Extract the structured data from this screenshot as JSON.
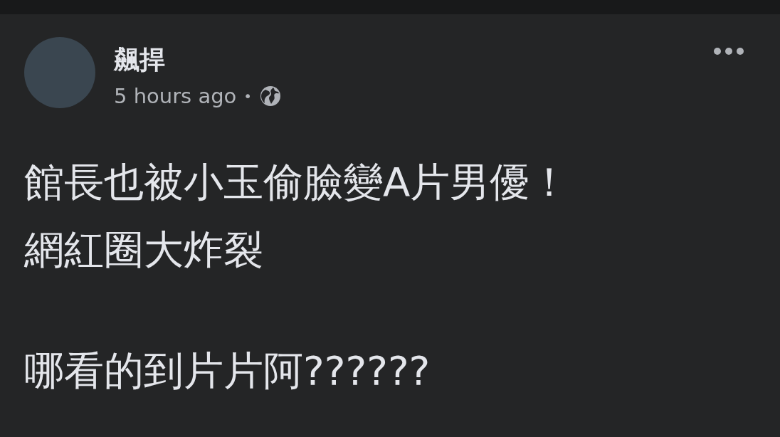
{
  "post": {
    "author": "飆捍",
    "time": "5 hours ago",
    "separator": "•",
    "paragraphs": [
      [
        "館長也被小玉偷臉變A片男優！",
        "網紅圈大炸裂"
      ],
      [
        "哪看的到片片阿??????"
      ]
    ]
  }
}
